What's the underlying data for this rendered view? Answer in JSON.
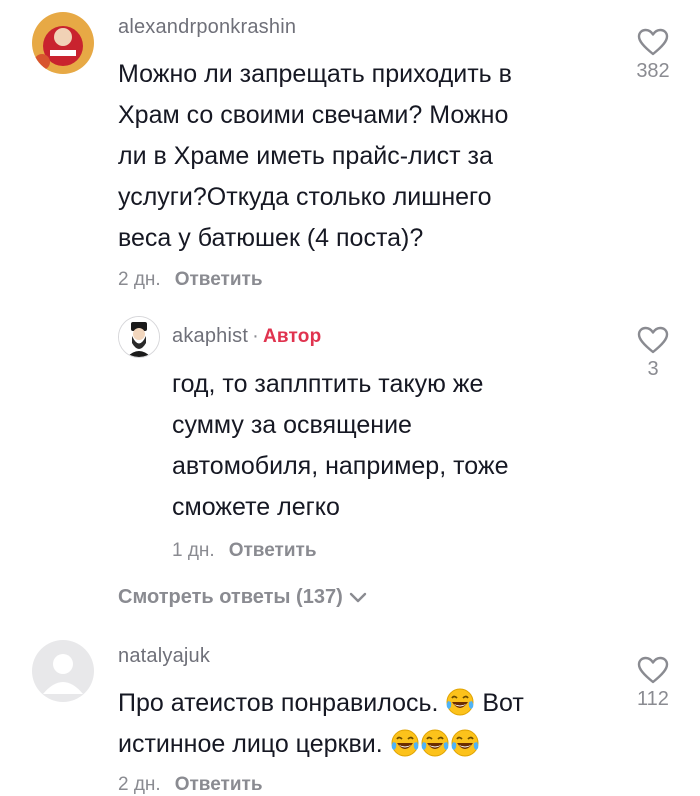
{
  "comments": [
    {
      "username": "alexandrponkrashin",
      "lines": [
        "Можно ли запрещать приходить в",
        "Храм со своими свечами? Можно",
        "ли в Храме иметь прайс-лист за",
        "услуги?Откуда столько лишнего",
        "веса у батюшек (4 поста)?"
      ],
      "time": "2 дн.",
      "reply_label": "Ответить",
      "likes": "382"
    },
    {
      "username": "akaphist",
      "badge": "Автор",
      "lines": [
        "год, то заплптить такую же",
        "сумму за освящение",
        "автомобиля, например, тоже",
        "сможете легко"
      ],
      "time": "1 дн.",
      "reply_label": "Ответить",
      "likes": "3"
    },
    {
      "username": "natalyajuk",
      "lines": [
        "Про атеистов понравилось.",
        "Вот",
        "истинное лицо церкви."
      ],
      "time": "2 дн.",
      "reply_label": "Ответить",
      "likes": "112"
    }
  ],
  "view_replies": "Смотреть ответы (137)",
  "icons": {
    "like": "heart-outline-icon",
    "expand": "chevron-down-icon",
    "emoji": "tears-of-joy-emoji"
  },
  "colors": {
    "author_badge": "#e0334f",
    "secondary_text": "#8a8b91"
  }
}
